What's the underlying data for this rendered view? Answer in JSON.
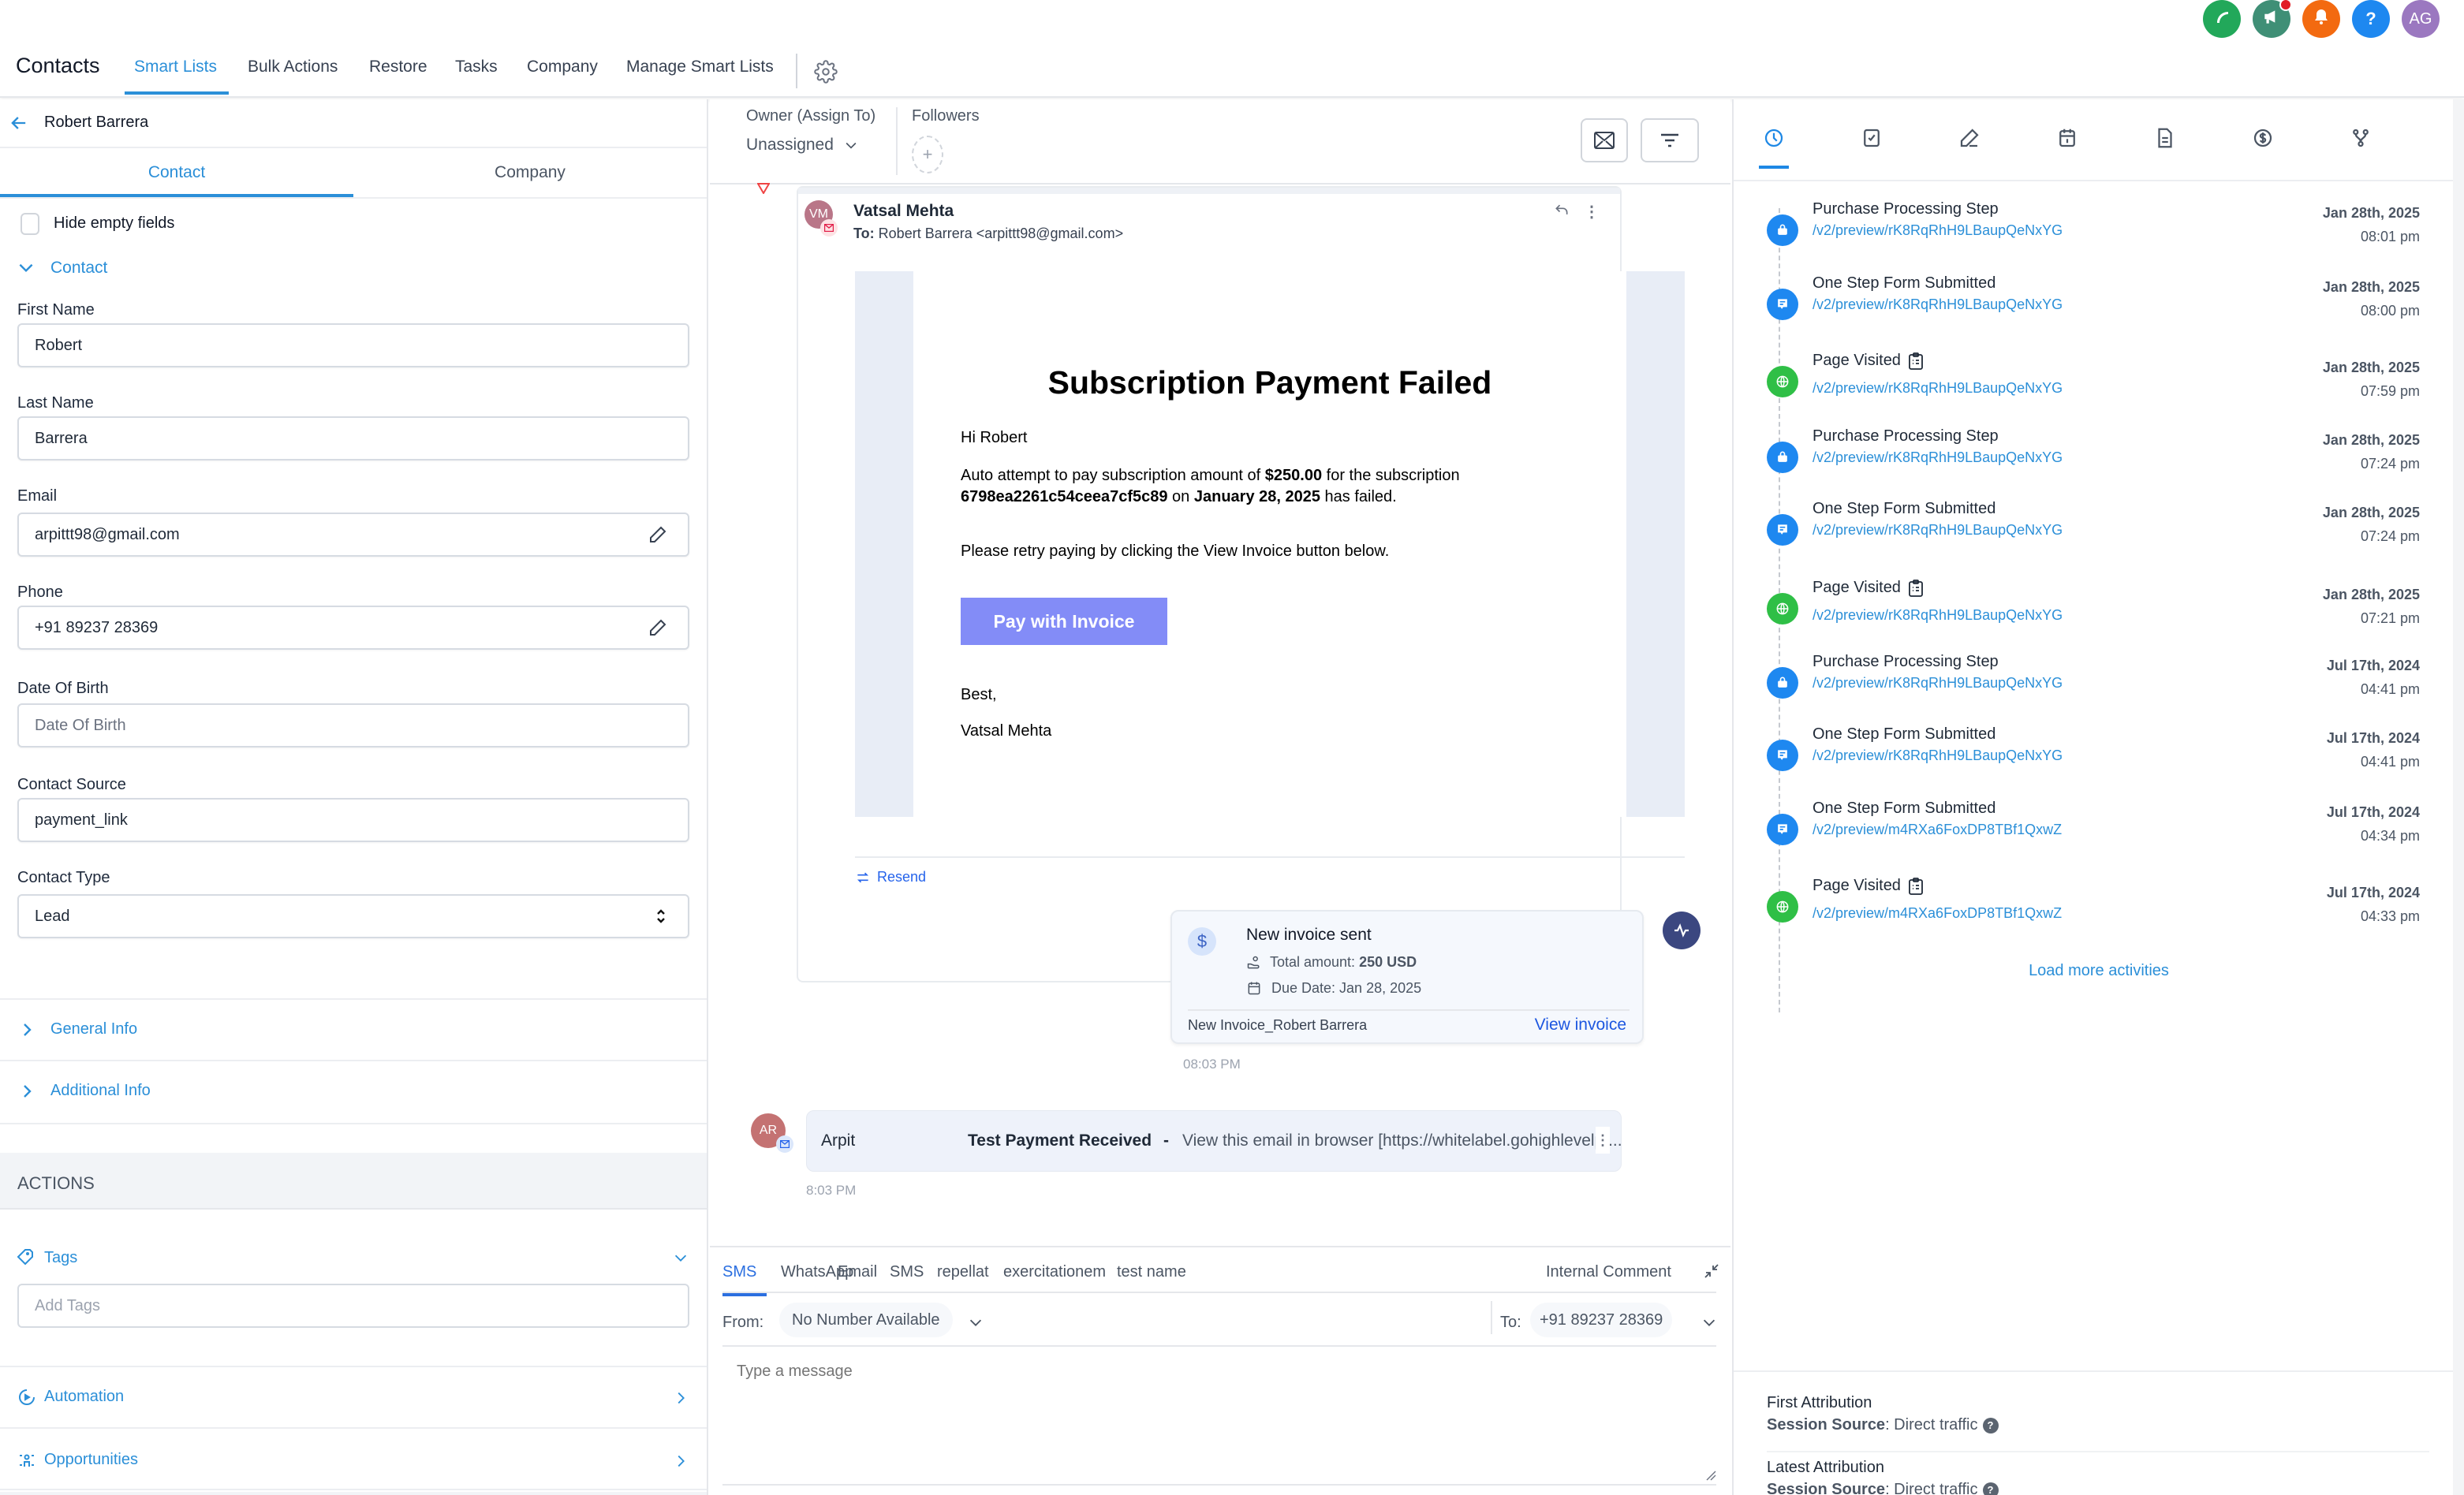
{
  "topbar": {
    "title": "Contacts",
    "tabs": [
      {
        "label": "Smart Lists",
        "active": true
      },
      {
        "label": "Bulk Actions",
        "active": false
      },
      {
        "label": "Restore",
        "active": false
      },
      {
        "label": "Tasks",
        "active": false
      },
      {
        "label": "Company",
        "active": false
      },
      {
        "label": "Manage Smart Lists",
        "active": false
      }
    ],
    "settings_icon": "gear-icon",
    "actions": [
      {
        "icon": "phone-icon",
        "color": "#22a85a"
      },
      {
        "icon": "megaphone-icon",
        "color": "#3f8f76",
        "badge_color": "#e11d24"
      },
      {
        "icon": "bell-icon",
        "color": "#f36a10"
      },
      {
        "icon": "help-icon",
        "label": "?",
        "color": "#1e88f0"
      },
      {
        "icon": "avatar",
        "label": "AG",
        "color": "#9b78c0"
      }
    ]
  },
  "left_panel": {
    "back_icon": "arrow-left-icon",
    "contact_name": "Robert Barrera",
    "tabs": [
      {
        "label": "Contact",
        "active": true
      },
      {
        "label": "Company",
        "active": false
      }
    ],
    "hide_empty_label": "Hide empty fields",
    "hide_empty_checked": false,
    "section_title": "Contact",
    "fields": {
      "first_name": {
        "label": "First Name",
        "value": "Robert"
      },
      "last_name": {
        "label": "Last Name",
        "value": "Barrera"
      },
      "email": {
        "label": "Email",
        "value": "arpittt98@gmail.com"
      },
      "phone": {
        "label": "Phone",
        "value": "+91 89237 28369"
      },
      "dob": {
        "label": "Date Of Birth",
        "placeholder": "Date Of Birth",
        "value": ""
      },
      "source": {
        "label": "Contact Source",
        "value": "payment_link"
      },
      "type": {
        "label": "Contact Type",
        "value": "Lead"
      }
    },
    "collapsed_sections": [
      "General Info",
      "Additional Info"
    ],
    "actions_header": "ACTIONS",
    "tags": {
      "label": "Tags",
      "placeholder": "Add Tags"
    },
    "automation_label": "Automation",
    "opportunities_label": "Opportunities"
  },
  "middle": {
    "owner_label": "Owner (Assign To)",
    "owner_value": "Unassigned",
    "followers_label": "Followers",
    "email_card": {
      "sender_initials": "VM",
      "sender_name": "Vatsal Mehta",
      "to_label": "To:",
      "to_value": "Robert Barrera <arpittt98@gmail.com>",
      "heading": "Subscription Payment Failed",
      "greeting": "Hi Robert",
      "body_1a": "Auto attempt to pay subscription amount of ",
      "amount": "$250.00",
      "body_1b": " for the subscription",
      "subscription_id": "6798ea2261c54ceea7cf5c89",
      "body_1c": " on ",
      "date": "January 28, 2025",
      "body_1d": " has failed.",
      "body_2": "Please retry paying by clicking the View Invoice button below.",
      "pay_button": "Pay with Invoice",
      "pay_button_color": "#838cf7",
      "signoff": "Best,",
      "signature": "Vatsal Mehta",
      "resend_label": "Resend"
    },
    "invoice_card": {
      "title": "New invoice sent",
      "total_label": "Total amount: ",
      "total_value": "250 USD",
      "due_label": "Due Date: Jan 28, 2025",
      "invoice_name": "New Invoice_Robert Barrera",
      "view_label": "View invoice",
      "time": "08:03 PM"
    },
    "email_row": {
      "initials": "AR",
      "sender": "Arpit",
      "subject": "Test Payment Received",
      "separator": "-",
      "preview": "View this email in browser [https://whitelabel.gohighlevelpr...",
      "time": "8:03 PM"
    },
    "composer": {
      "channels": [
        "SMS",
        "WhatsApp",
        "Email",
        "SMS",
        "repellat",
        "exercitationem",
        "test name"
      ],
      "active_channel": 0,
      "internal_comment": "Internal Comment",
      "from_label": "From:",
      "from_value": "No Number Available",
      "to_label": "To:",
      "to_value": "+91 89237 28369",
      "placeholder": "Type a message"
    }
  },
  "right_panel": {
    "tabs": [
      "activity-icon",
      "task-icon",
      "note-icon",
      "calendar-icon",
      "document-icon",
      "payment-icon",
      "workflow-icon"
    ],
    "active_tab": 0,
    "activities": [
      {
        "type": "purchase",
        "title": "Purchase Processing Step",
        "link": "/v2/preview/rK8RqRhH9LBaupQeNxYG",
        "date": "Jan 28th, 2025",
        "time": "08:01 pm"
      },
      {
        "type": "form",
        "title": "One Step Form Submitted",
        "link": "/v2/preview/rK8RqRhH9LBaupQeNxYG",
        "date": "Jan 28th, 2025",
        "time": "08:00 pm"
      },
      {
        "type": "page",
        "title": "Page Visited",
        "link": "/v2/preview/rK8RqRhH9LBaupQeNxYG",
        "date": "Jan 28th, 2025",
        "time": "07:59 pm"
      },
      {
        "type": "purchase",
        "title": "Purchase Processing Step",
        "link": "/v2/preview/rK8RqRhH9LBaupQeNxYG",
        "date": "Jan 28th, 2025",
        "time": "07:24 pm"
      },
      {
        "type": "form",
        "title": "One Step Form Submitted",
        "link": "/v2/preview/rK8RqRhH9LBaupQeNxYG",
        "date": "Jan 28th, 2025",
        "time": "07:24 pm"
      },
      {
        "type": "page",
        "title": "Page Visited",
        "link": "/v2/preview/rK8RqRhH9LBaupQeNxYG",
        "date": "Jan 28th, 2025",
        "time": "07:21 pm"
      },
      {
        "type": "purchase",
        "title": "Purchase Processing Step",
        "link": "/v2/preview/rK8RqRhH9LBaupQeNxYG",
        "date": "Jul 17th, 2024",
        "time": "04:41 pm"
      },
      {
        "type": "form",
        "title": "One Step Form Submitted",
        "link": "/v2/preview/rK8RqRhH9LBaupQeNxYG",
        "date": "Jul 17th, 2024",
        "time": "04:41 pm"
      },
      {
        "type": "form",
        "title": "One Step Form Submitted",
        "link": "/v2/preview/m4RXa6FoxDP8TBf1QxwZ",
        "date": "Jul 17th, 2024",
        "time": "04:34 pm"
      },
      {
        "type": "page",
        "title": "Page Visited",
        "link": "/v2/preview/m4RXa6FoxDP8TBf1QxwZ",
        "date": "Jul 17th, 2024",
        "time": "04:33 pm"
      }
    ],
    "load_more": "Load more activities",
    "attribution": {
      "first_title": "First Attribution",
      "first_label": "Session Source",
      "first_value": ": Direct traffic",
      "latest_title": "Latest Attribution",
      "latest_label": "Session Source",
      "latest_value": ": Direct traffic"
    }
  }
}
